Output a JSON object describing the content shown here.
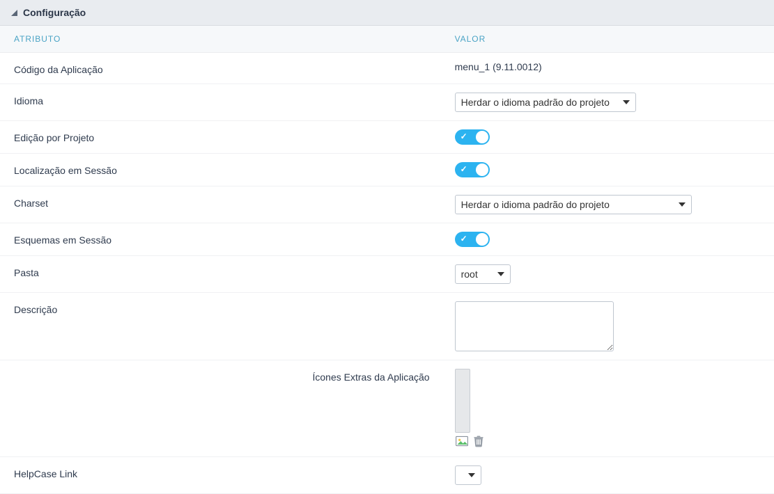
{
  "panel": {
    "title": "Configuração"
  },
  "headers": {
    "attribute": "ATRIBUTO",
    "value": "VALOR"
  },
  "rows": {
    "app_code": {
      "label": "Código da Aplicação",
      "value": "menu_1 (9.11.0012)"
    },
    "language": {
      "label": "Idioma",
      "selected": "Herdar o idioma padrão do projeto"
    },
    "edit_by_project": {
      "label": "Edição por Projeto",
      "on": true
    },
    "session_locale": {
      "label": "Localização em Sessão",
      "on": true
    },
    "charset": {
      "label": "Charset",
      "selected": "Herdar o idioma padrão do projeto"
    },
    "session_schemas": {
      "label": "Esquemas em Sessão",
      "on": true
    },
    "folder": {
      "label": "Pasta",
      "selected": "root"
    },
    "description": {
      "label": "Descrição",
      "value": ""
    },
    "extra_icons": {
      "label": "Ícones Extras da Aplicação"
    },
    "helpcase": {
      "label": "HelpCase Link",
      "selected": ""
    }
  }
}
